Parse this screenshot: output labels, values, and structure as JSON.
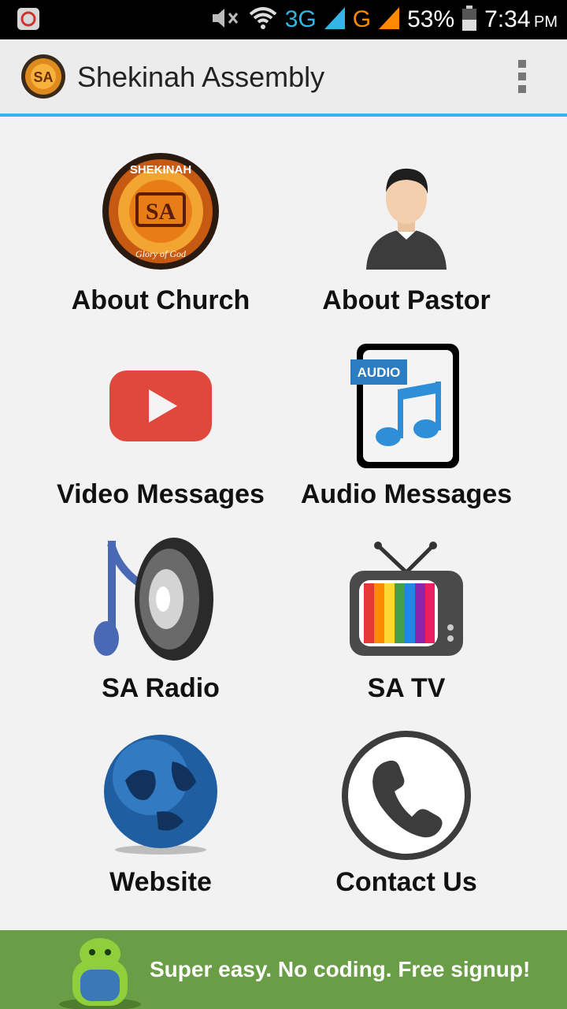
{
  "status_bar": {
    "network_3g": "3G",
    "network_g": "G",
    "battery_percent": "53%",
    "time": "7:34",
    "ampm": "PM",
    "icons": [
      "app-notification-icon",
      "mute-icon",
      "wifi-icon",
      "signal-icon",
      "battery-icon"
    ]
  },
  "action_bar": {
    "title": "Shekinah Assembly",
    "logo_text": "SA",
    "menu_icon": "overflow-menu-icon"
  },
  "menu": {
    "about_church": "About Church",
    "about_pastor": "About Pastor",
    "video_messages": "Video Messages",
    "audio_messages": "Audio Messages",
    "sa_radio": "SA Radio",
    "sa_tv": "SA TV",
    "website": "Website",
    "contact_us": "Contact Us"
  },
  "icons": {
    "church_logo_top": "SHEKINAH",
    "church_logo_bottom": "Glory of God",
    "church_logo_center": "SA",
    "audio_badge": "AUDIO"
  },
  "footer": {
    "text": "Super easy. No coding. Free signup!"
  },
  "colors": {
    "accent": "#33b5e5",
    "footer_bg": "#6a9e46",
    "youtube_red": "#e0473d"
  }
}
